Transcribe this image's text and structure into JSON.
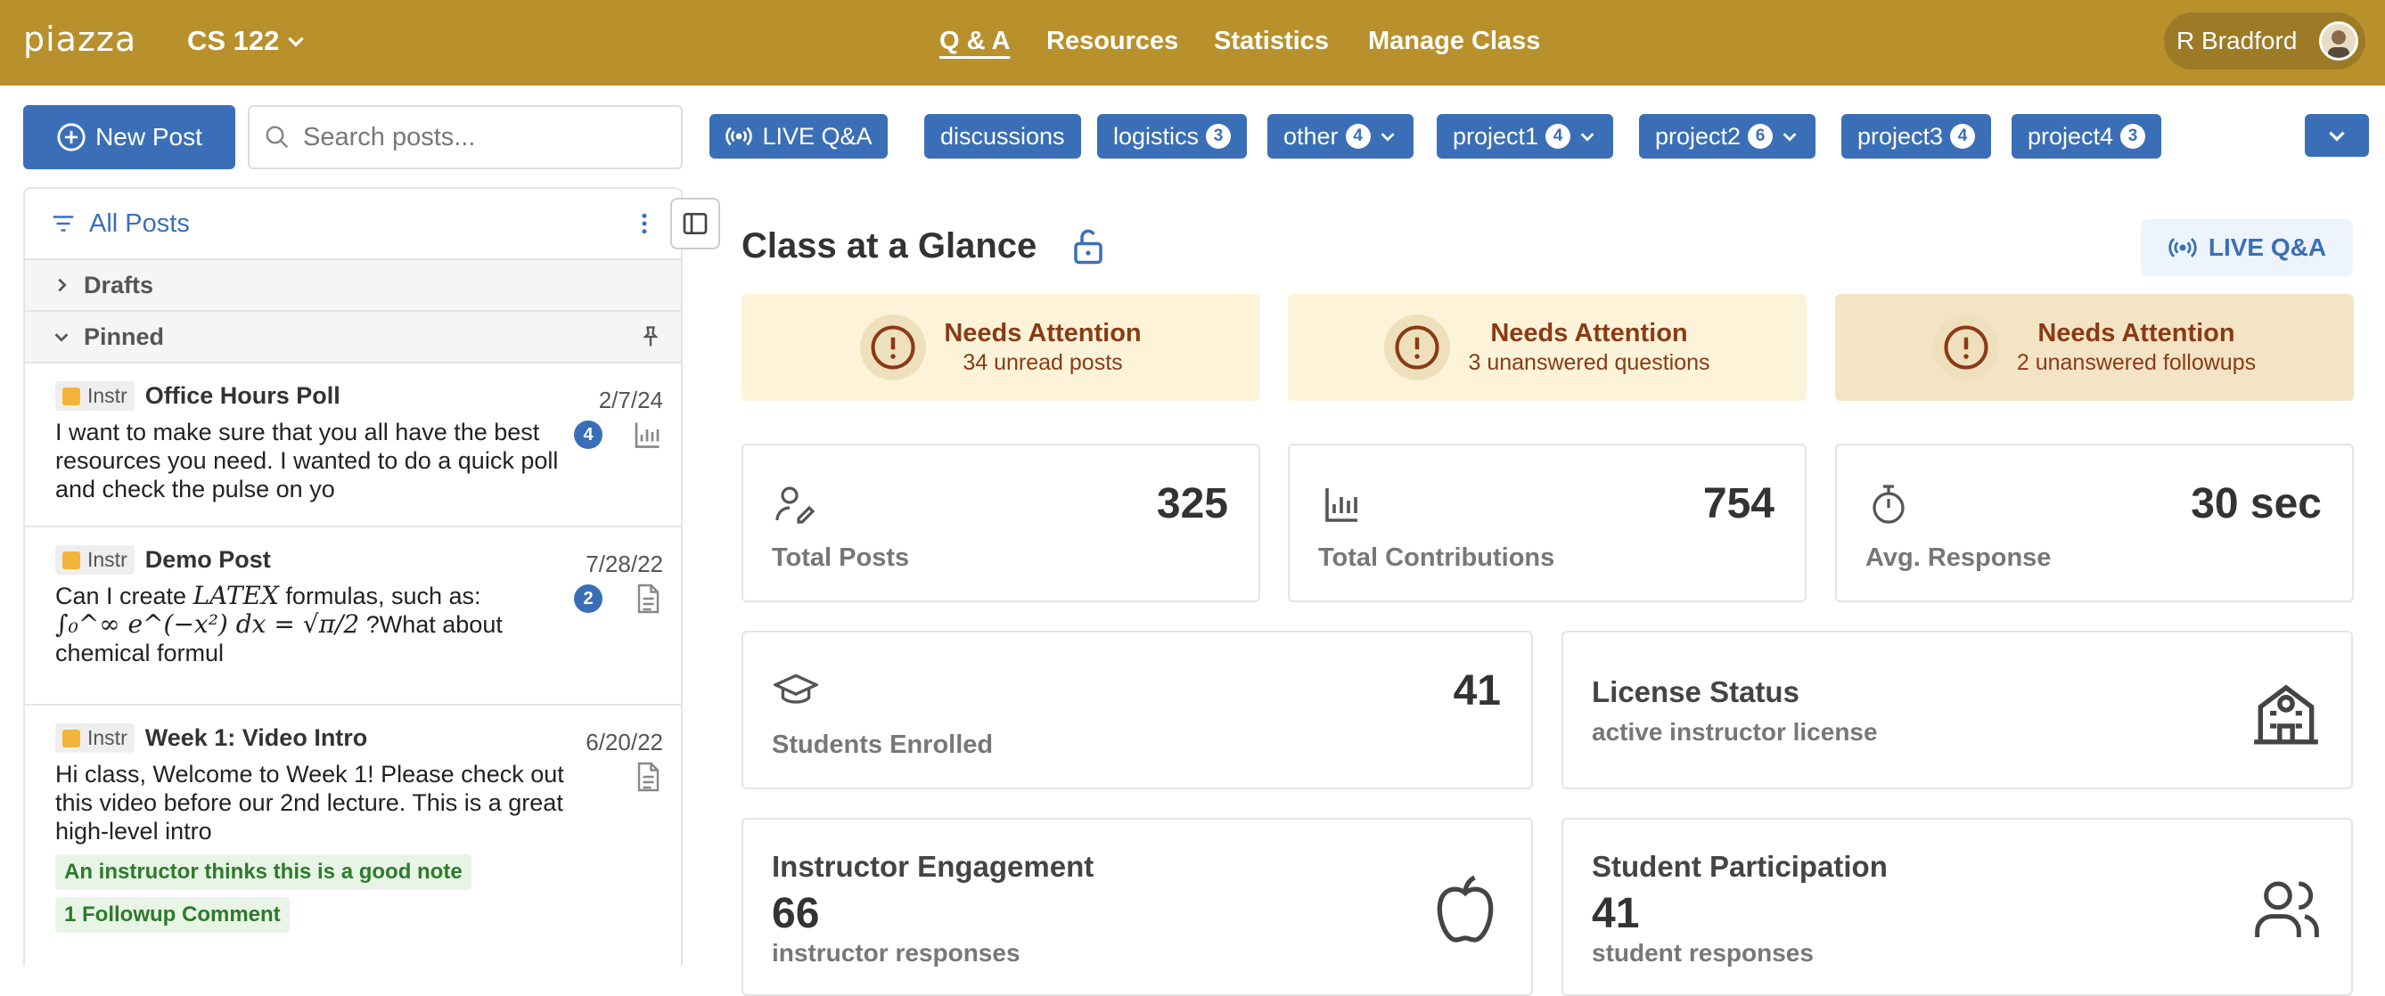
{
  "header": {
    "logo": "piazza",
    "course": "CS 122",
    "nav": [
      "Q & A",
      "Resources",
      "Statistics",
      "Manage Class"
    ],
    "user": "R Bradford"
  },
  "toolbar": {
    "new_post": "New Post",
    "search_placeholder": "Search posts...",
    "live_qa": "LIVE Q&A",
    "folders": [
      {
        "label": "discussions"
      },
      {
        "label": "logistics",
        "count": "3"
      },
      {
        "label": "other",
        "count": "4"
      },
      {
        "label": "project1",
        "count": "4"
      },
      {
        "label": "project2",
        "count": "6"
      },
      {
        "label": "project3",
        "count": "4"
      },
      {
        "label": "project4",
        "count": "3"
      }
    ]
  },
  "sidebar": {
    "all_posts": "All Posts",
    "drafts": "Drafts",
    "pinned": "Pinned",
    "posts": [
      {
        "tag": "Instr",
        "title": "Office Hours Poll",
        "date": "2/7/24",
        "body": "I want to make sure that you all have the best resources you need. I wanted to do a quick poll and check the pulse on yo",
        "badge": "4"
      },
      {
        "tag": "Instr",
        "title": "Demo Post",
        "date": "7/28/22",
        "body_pre": "Can I create ",
        "latex": "LATEX",
        "body_mid": " formulas, such as:",
        "formula": "∫₀^∞ e^(−x²) dx = √π/2",
        "body_post": " ?What about chemical formul",
        "badge": "2"
      },
      {
        "tag": "Instr",
        "title": "Week 1: Video Intro",
        "date": "6/20/22",
        "body": "Hi class,  Welcome to Week 1! Please check out this video before our 2nd lecture. This is a great high-level intro",
        "note": "An instructor thinks this is a good note",
        "followup": "1 Followup Comment"
      }
    ]
  },
  "main": {
    "title": "Class at a Glance",
    "live_qa": "LIVE Q&A",
    "attention": [
      {
        "title": "Needs Attention",
        "sub": "34 unread posts"
      },
      {
        "title": "Needs Attention",
        "sub": "3 unanswered questions"
      },
      {
        "title": "Needs Attention",
        "sub": "2 unanswered followups"
      }
    ],
    "stats": [
      {
        "value": "325",
        "label": "Total Posts"
      },
      {
        "value": "754",
        "label": "Total Contributions"
      },
      {
        "value": "30 sec",
        "label": "Avg. Response"
      }
    ],
    "students": {
      "value": "41",
      "label": "Students Enrolled"
    },
    "license": {
      "title": "License Status",
      "sub": "active instructor license"
    },
    "instructor": {
      "title": "Instructor Engagement",
      "value": "66",
      "sub": "instructor responses"
    },
    "participation": {
      "title": "Student Participation",
      "value": "41",
      "sub": "student responses"
    }
  },
  "colors": {
    "header": "#b8902c",
    "accent": "#3a6fb8",
    "attention_text": "#8b3a14"
  }
}
